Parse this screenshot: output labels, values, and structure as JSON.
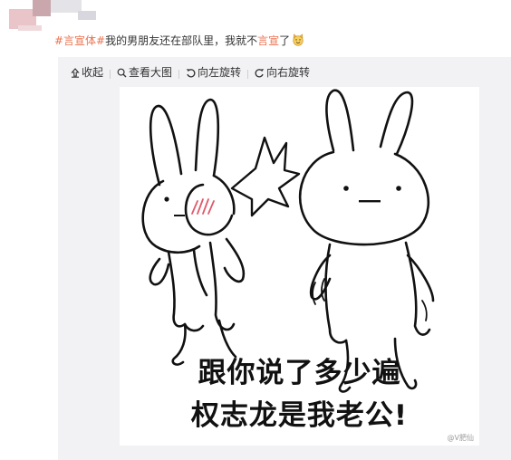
{
  "post": {
    "hashtag": "#言宣体#",
    "text_before": "我的男朋友还在部队里，我就不",
    "highlight": "言宣",
    "text_after": "了",
    "emoji": "smiling-cat-emoji"
  },
  "toolbar": {
    "collapse_label": "收起",
    "view_large_label": "查看大图",
    "rotate_left_label": "向左旋转",
    "rotate_right_label": "向右旋转"
  },
  "image": {
    "caption_line1": "跟你说了多少遍",
    "caption_line2": "权志龙是我老公!",
    "watermark": "@V肥仙"
  },
  "colors": {
    "accent": "#eb7350",
    "media_bg": "#f2f2f5",
    "blush": "#e05a6a"
  }
}
